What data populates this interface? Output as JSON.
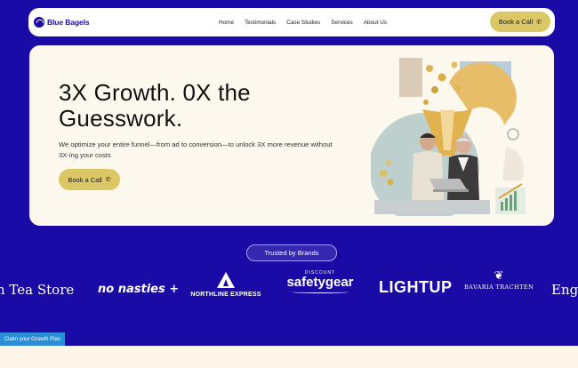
{
  "brand": {
    "name": "Blue Bagels",
    "color": "#1a0aa6"
  },
  "nav": {
    "links": [
      "Home",
      "Testimonials",
      "Case Studies",
      "Services",
      "About Us"
    ],
    "cta_label": "Book a Call",
    "cta_icon": "phone-icon"
  },
  "hero": {
    "title": "3X Growth. 0X the Guesswork.",
    "subtitle": "We optimize your entire funnel—from ad to conversion—to unlock 3X more revenue without 3X-ing your costs",
    "cta_label": "Book a Call",
    "image": "marketing-collage-two-men-laptop-funnel-coins"
  },
  "trusted_label": "Trusted by Brands",
  "brands": [
    "h Tea Store",
    "no nasties +",
    "NORTHLINE EXPRESS",
    "DISCOUNT",
    "safetygear",
    "LIGHTUP",
    "BAVARIA TRACHTEN",
    "Eng"
  ],
  "claim_label": "Claim your Growth Plan",
  "colors": {
    "accent": "#dbc766",
    "hero_bg": "#fcf8ee",
    "page_bg": "#1a0aa6",
    "claim_bg": "#2a8ed6"
  }
}
